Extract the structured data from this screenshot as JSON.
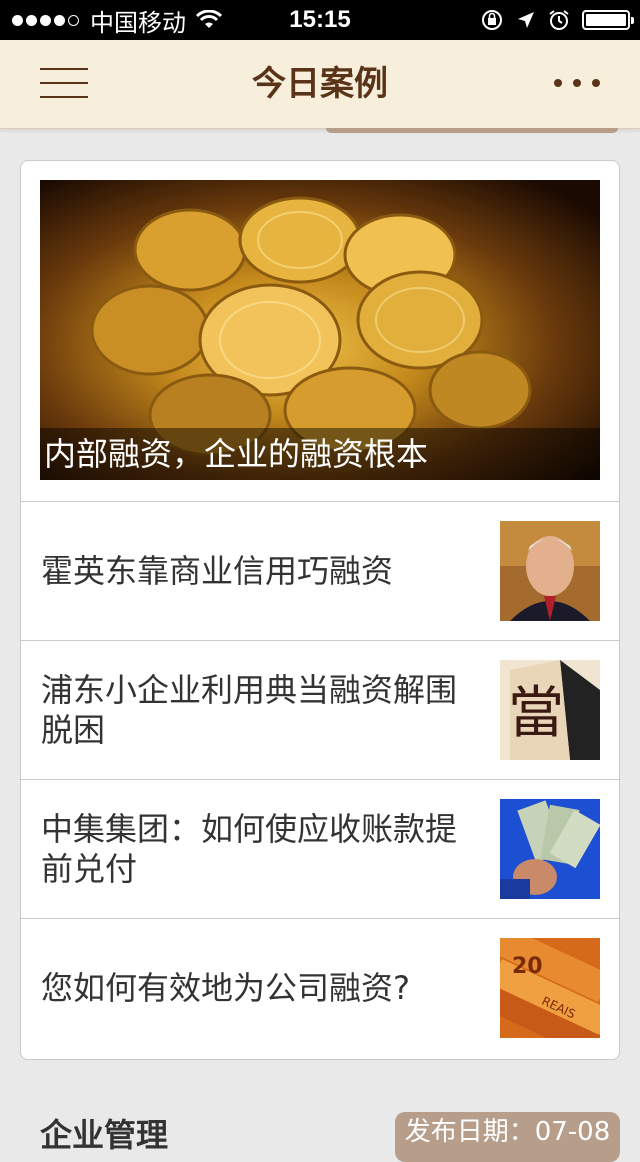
{
  "status_bar": {
    "carrier": "中国移动",
    "time": "15:15"
  },
  "nav": {
    "title": "今日案例"
  },
  "hero": {
    "caption": "内部融资，企业的融资根本",
    "image_icon": "gold-coins-image"
  },
  "articles": [
    {
      "title": "霍英东靠商业信用巧融资",
      "thumb_icon": "portrait-thumbnail"
    },
    {
      "title": "浦东小企业利用典当融资解围脱困",
      "thumb_icon": "pawnshop-sign-thumbnail"
    },
    {
      "title": "中集集团：如何使应收账款提前兑付",
      "thumb_icon": "dollar-bills-thumbnail"
    },
    {
      "title": "您如何有效地为公司融资?",
      "thumb_icon": "reais-banknotes-thumbnail"
    }
  ],
  "next_section": {
    "title": "企业管理",
    "date_label": "发布日期：07-08"
  },
  "colors": {
    "nav_bg": "#f7efdc",
    "nav_text": "#5a3418",
    "badge_bg": "#b79e8b"
  }
}
